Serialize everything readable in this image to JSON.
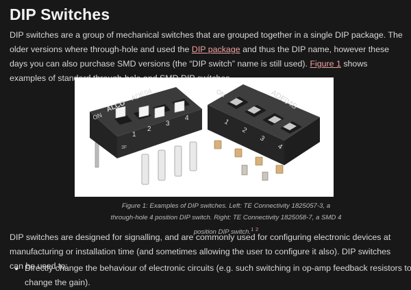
{
  "title": "DIP Switches",
  "intro": {
    "part1": "DIP switches are a group of mechanical switches that are grouped together in a single DIP package. The older versions where through-hole and used the ",
    "link1": "DIP package",
    "part2": " and thus the DIP name, however these days you can also purchase SMD versions (the “DIP switch” name is still used). ",
    "link2": "Figure 1",
    "part3": " shows examples of standard through-hole and SMD DIP switches."
  },
  "figure": {
    "left_brand": "ALCO",
    "left_model": "ADE04",
    "left_on": "ON",
    "left_numbers": [
      "1",
      "2",
      "3",
      "4"
    ],
    "left_code": "3F",
    "right_on": "ON",
    "right_model": "ADE04S",
    "right_numbers": [
      "1",
      "2",
      "3",
      "4"
    ],
    "caption": "Figure 1: Examples of DIP switches. Left: TE Connectivity 1825057-3, a through-hole 4 position DIP switch. Right: TE Connectivity 1825058-7, a SMD 4 position DIP switch.",
    "ref1": "1",
    "ref2": "2"
  },
  "para2": "DIP switches are designed for signalling, and are commonly used for configuring electronic devices at manufacturing or installation time (and sometimes allowing the user to configure it also). DIP switches can be used to:",
  "list": [
    "Directly change the behaviour of electronic circuits (e.g. such switching in op-amp feedback resistors to change the gain)."
  ]
}
